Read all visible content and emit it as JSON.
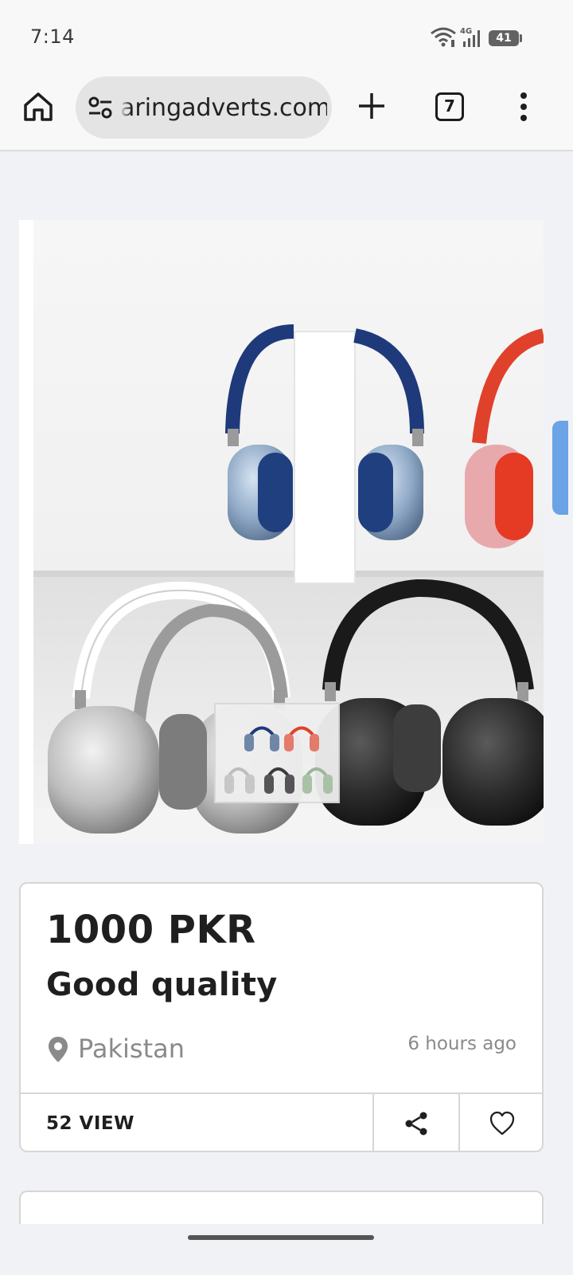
{
  "status_bar": {
    "time": "7:14",
    "network_label": "4G",
    "battery_level": "41"
  },
  "browser": {
    "url": "aringadverts.com",
    "tab_count": "7",
    "icons": [
      "home-icon",
      "site-settings-icon",
      "new-tab-icon",
      "tab-switcher-icon",
      "more-menu-icon"
    ]
  },
  "listing": {
    "image_alt_icons": [
      "headphones-image"
    ],
    "price": "1000 PKR",
    "title": "Good quality",
    "location": "Pakistan",
    "posted": "6 hours ago",
    "views": "52 VIEW",
    "actions": [
      "share-icon",
      "heart-icon"
    ]
  },
  "colors": {
    "page_bg": "#f1f2f6",
    "text": "#1f1f1f",
    "muted": "#8a8a8a",
    "border": "#d6d6d6",
    "accent_handle": "#6aa3e6"
  }
}
